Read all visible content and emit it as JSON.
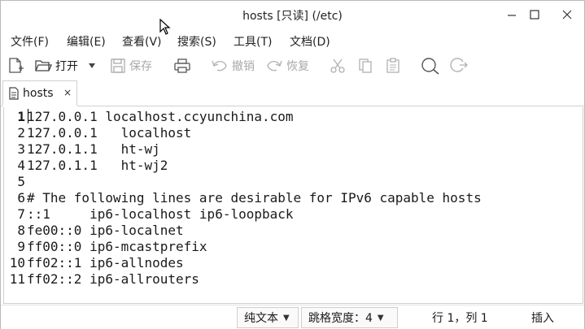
{
  "window": {
    "title": "hosts [只读] (/etc)"
  },
  "menu": {
    "file": "文件(F)",
    "edit": "编辑(E)",
    "view": "查看(V)",
    "search": "搜索(S)",
    "tools": "工具(T)",
    "docs": "文档(D)"
  },
  "toolbar": {
    "open_label": "打开",
    "save_label": "保存",
    "undo_label": "撤销",
    "redo_label": "恢复"
  },
  "tab": {
    "label": "hosts",
    "close": "×"
  },
  "editor": {
    "line_numbers": [
      "1",
      "2",
      "3",
      "4",
      "5",
      "6",
      "7",
      "8",
      "9",
      "10",
      "11"
    ],
    "lines": [
      "127.0.0.1 localhost.ccyunchina.com",
      "127.0.0.1   localhost",
      "127.0.1.1   ht-wj",
      "127.0.1.1   ht-wj2",
      "",
      "# The following lines are desirable for IPv6 capable hosts",
      "::1     ip6-localhost ip6-loopback",
      "fe00::0 ip6-localnet",
      "ff00::0 ip6-mcastprefix",
      "ff02::1 ip6-allnodes",
      "ff02::2 ip6-allrouters"
    ]
  },
  "status": {
    "syntax": "纯文本",
    "tab_width": "跳格宽度：4",
    "position": "行 1，列 1",
    "mode": "插入"
  },
  "colors": {
    "disabled_text": "#a9a9a9",
    "border": "#cfcfcf"
  }
}
